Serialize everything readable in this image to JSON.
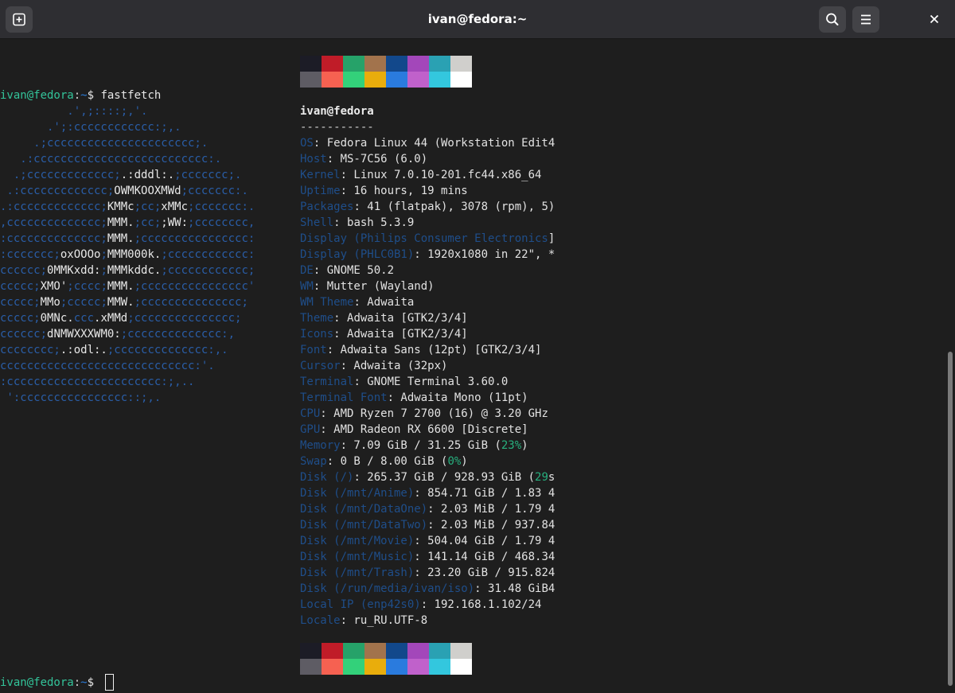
{
  "window": {
    "title": "ivan@fedora:~",
    "icons": {
      "new_tab": "new-tab-icon",
      "search": "search-icon",
      "menu": "menu-icon",
      "close": "close-icon"
    }
  },
  "terminal": {
    "prompt": {
      "user_host": "ivan@fedora",
      "separator": ":",
      "path": "~",
      "symbol": "$ "
    },
    "command": "fastfetch",
    "logo_lines": [
      [
        {
          "t": "          .',;::::;,'."
        }
      ],
      [
        {
          "t": "       .';:cccccccccccc:;,."
        }
      ],
      [
        {
          "t": "     .;cccccccccccccccccccccc;."
        }
      ],
      [
        {
          "t": "   .:cccccccccccccccccccccccccc:."
        }
      ],
      [
        {
          "t": "  .;ccccccccccccc;"
        },
        {
          "t": ".:dddl:.",
          "w": 1
        },
        {
          "t": ";ccccccc;."
        }
      ],
      [
        {
          "t": " .:ccccccccccccc;"
        },
        {
          "t": "OWMKOOXMWd",
          "w": 1
        },
        {
          "t": ";ccccccc:."
        }
      ],
      [
        {
          "t": ".:ccccccccccccc;"
        },
        {
          "t": "KMMc",
          "w": 1
        },
        {
          "t": ";cc;"
        },
        {
          "t": "xMMc",
          "w": 1
        },
        {
          "t": ";ccccccc:."
        }
      ],
      [
        {
          "t": ",cccccccccccccc;"
        },
        {
          "t": "MMM.",
          "w": 1
        },
        {
          "t": ";cc;"
        },
        {
          "t": ";WW:",
          "w": 1
        },
        {
          "t": ";cccccccc,"
        }
      ],
      [
        {
          "t": ":cccccccccccccc;"
        },
        {
          "t": "MMM.",
          "w": 1
        },
        {
          "t": ";cccccccccccccccc:"
        }
      ],
      [
        {
          "t": ":ccccccc;"
        },
        {
          "t": "oxOOOo",
          "w": 1
        },
        {
          "t": ";"
        },
        {
          "t": "MMM000k.",
          "w": 1
        },
        {
          "t": ";cccccccccccc:"
        }
      ],
      [
        {
          "t": "cccccc;"
        },
        {
          "t": "0MMKxdd:",
          "w": 1
        },
        {
          "t": ";"
        },
        {
          "t": "MMMkddc.",
          "w": 1
        },
        {
          "t": ";cccccccccccc;"
        }
      ],
      [
        {
          "t": "ccccc;"
        },
        {
          "t": "XMO'",
          "w": 1
        },
        {
          "t": ";cccc;"
        },
        {
          "t": "MMM.",
          "w": 1
        },
        {
          "t": ";cccccccccccccccc'"
        }
      ],
      [
        {
          "t": "ccccc;"
        },
        {
          "t": "MMo",
          "w": 1
        },
        {
          "t": ";ccccc;"
        },
        {
          "t": "MMW.",
          "w": 1
        },
        {
          "t": ";ccccccccccccccc;"
        }
      ],
      [
        {
          "t": "ccccc;"
        },
        {
          "t": "0MNc.",
          "w": 1
        },
        {
          "t": "ccc"
        },
        {
          "t": ".xMMd",
          "w": 1
        },
        {
          "t": ";ccccccccccccccc;"
        }
      ],
      [
        {
          "t": "cccccc;"
        },
        {
          "t": "dNMWXXXWM0:",
          "w": 1
        },
        {
          "t": ";cccccccccccccc:,"
        }
      ],
      [
        {
          "t": "cccccccc;"
        },
        {
          "t": ".:odl:.",
          "w": 1
        },
        {
          "t": ";cccccccccccccc:,."
        }
      ],
      [
        {
          "t": "ccccccccccccccccccccccccccccc:'."
        }
      ],
      [
        {
          "t": ":ccccccccccccccccccccccc:;,.."
        }
      ],
      [
        {
          "t": " ':cccccccccccccccc::;,."
        }
      ]
    ],
    "user_host_heading": "ivan@fedora",
    "separator_line": "-----------",
    "info": [
      {
        "key": "OS",
        "value": ": Fedora Linux 44 (Workstation Edit4"
      },
      {
        "key": "Host",
        "value": ": MS-7C56 (6.0)"
      },
      {
        "key": "Kernel",
        "value": ": Linux 7.0.10-201.fc44.x86_64"
      },
      {
        "key": "Uptime",
        "value": ": 16 hours, 19 mins"
      },
      {
        "key": "Packages",
        "value": ": 41 (flatpak), 3078 (rpm), 5)"
      },
      {
        "key": "Shell",
        "value": ": bash 5.3.9"
      },
      {
        "key": "Display (Philips Consumer Electronics",
        "value": "]"
      },
      {
        "key": "Display (PHLC0B1)",
        "value": ": 1920x1080 in 22\", *"
      },
      {
        "key": "DE",
        "value": ": GNOME 50.2"
      },
      {
        "key": "WM",
        "value": ": Mutter (Wayland)"
      },
      {
        "key": "WM Theme",
        "value": ": Adwaita"
      },
      {
        "key": "Theme",
        "value": ": Adwaita [GTK2/3/4]"
      },
      {
        "key": "Icons",
        "value": ": Adwaita [GTK2/3/4]"
      },
      {
        "key": "Font",
        "value": ": Adwaita Sans (12pt) [GTK2/3/4]"
      },
      {
        "key": "Cursor",
        "value": ": Adwaita (32px)"
      },
      {
        "key": "Terminal",
        "value": ": GNOME Terminal 3.60.0"
      },
      {
        "key": "Terminal Font",
        "value": ": Adwaita Mono (11pt)"
      },
      {
        "key": "CPU",
        "value": ": AMD Ryzen 7 2700 (16) @ 3.20 GHz"
      },
      {
        "key": "GPU",
        "value": ": AMD Radeon RX 6600 [Discrete]"
      },
      {
        "key": "Memory",
        "value": ": 7.09 GiB / 31.25 GiB (",
        "pct": "23%",
        "tail": ")"
      },
      {
        "key": "Swap",
        "value": ": 0 B / 8.00 GiB (",
        "pct": "0%",
        "tail": ")"
      },
      {
        "key": "Disk (/)",
        "value": ": 265.37 GiB / 928.93 GiB (",
        "pct": "29",
        "tail": "s"
      },
      {
        "key": "Disk (/mnt/Anime)",
        "value": ": 854.71 GiB / 1.83 4"
      },
      {
        "key": "Disk (/mnt/DataOne)",
        "value": ": 2.03 MiB / 1.79 4"
      },
      {
        "key": "Disk (/mnt/DataTwo)",
        "value": ": 2.03 MiB / 937.84"
      },
      {
        "key": "Disk (/mnt/Movie)",
        "value": ": 504.04 GiB / 1.79 4"
      },
      {
        "key": "Disk (/mnt/Music)",
        "value": ": 141.14 GiB / 468.34"
      },
      {
        "key": "Disk (/mnt/Trash)",
        "value": ": 23.20 GiB / 915.824"
      },
      {
        "key": "Disk (/run/media/ivan/iso)",
        "value": ": 31.48 GiB4"
      },
      {
        "key": "Local IP (enp42s0)",
        "value": ": 192.168.1.102/24"
      },
      {
        "key": "Locale",
        "value": ": ru_RU.UTF-8"
      }
    ],
    "palette": {
      "normal": [
        "#1c1c26",
        "#c01c28",
        "#26a269",
        "#a2734c",
        "#12488b",
        "#a347ba",
        "#2aa1b3",
        "#d0cfcc"
      ],
      "bright": [
        "#5e5c64",
        "#f66151",
        "#33d17a",
        "#e9ad0c",
        "#2a7bde",
        "#c061cb",
        "#33c7de",
        "#ffffff"
      ]
    }
  }
}
